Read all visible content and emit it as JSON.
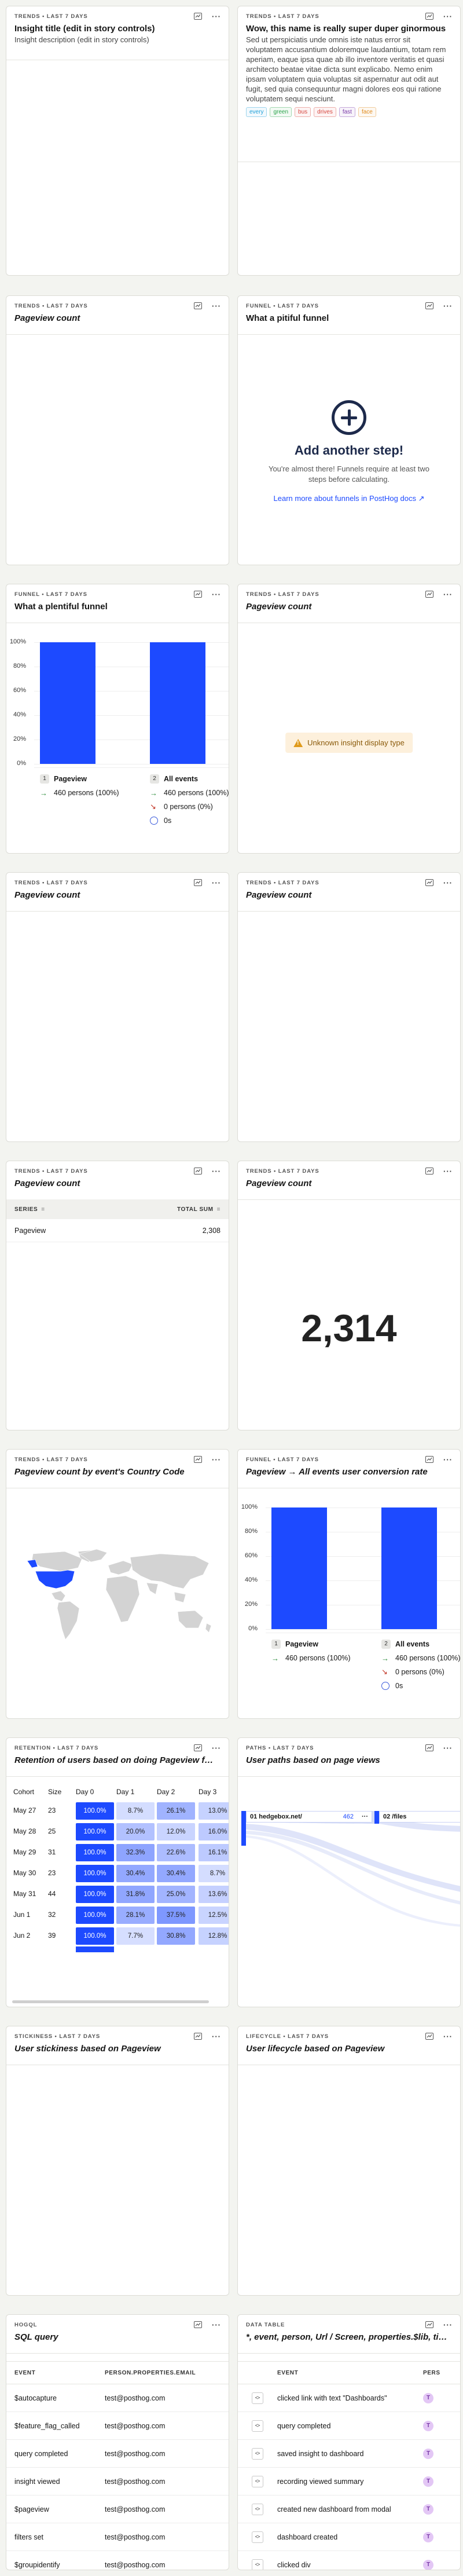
{
  "icons": {
    "chart_icon": "insight-icon",
    "more_icon": "more-icon"
  },
  "cards": {
    "c1": {
      "meta": "TRENDS • LAST 7 DAYS",
      "title": "Insight title (edit in story controls)",
      "desc": "Insight description (edit in story controls)"
    },
    "c2": {
      "meta": "TRENDS • LAST 7 DAYS",
      "title": "Wow, this name is really super duper ginormous",
      "desc": "Sed ut perspiciatis unde omnis iste natus error sit voluptatem accusantium doloremque laudantium, totam rem aperiam, eaque ipsa quae ab illo inventore veritatis et quasi architecto beatae vitae dicta sunt explicabo. Nemo enim ipsam voluptatem quia voluptas sit aspernatur aut odit aut fugit, sed quia consequuntur magni dolores eos qui ratione voluptatem sequi nesciunt.",
      "tags": [
        "every",
        "green",
        "bus",
        "drives",
        "fast",
        "face"
      ],
      "tag_colors": [
        "#1d9fd8",
        "#2aa34a",
        "#d6453d",
        "#d6453d",
        "#7a3aa8",
        "#e08a1a"
      ]
    },
    "c3": {
      "meta": "TRENDS • LAST 7 DAYS",
      "title": "Pageview count"
    },
    "c4": {
      "meta": "FUNNEL • LAST 7 DAYS",
      "title": "What a pitiful funnel",
      "empty_title": "Add another step!",
      "empty_text": "You're almost there! Funnels require at least two steps before calculating.",
      "empty_link": "Learn more about funnels in PostHog docs ↗"
    },
    "c5": {
      "meta": "FUNNEL • LAST 7 DAYS",
      "title": "What a plentiful funnel",
      "y_ticks": [
        "100%",
        "80%",
        "60%",
        "40%",
        "20%",
        "0%"
      ],
      "step1": {
        "num": "1",
        "name": "Pageview",
        "persons": "460 persons (100%)"
      },
      "step2": {
        "num": "2",
        "name": "All events",
        "persons": "460 persons (100%)",
        "dropped": "0 persons (0%)",
        "time": "0s"
      }
    },
    "c6": {
      "meta": "TRENDS • LAST 7 DAYS",
      "title": "Pageview count",
      "warning": "Unknown insight display type"
    },
    "c7": {
      "meta": "TRENDS • LAST 7 DAYS",
      "title": "Pageview count"
    },
    "c8": {
      "meta": "TRENDS • LAST 7 DAYS",
      "title": "Pageview count"
    },
    "c9": {
      "meta": "TRENDS • LAST 7 DAYS",
      "title": "Pageview count",
      "col_series": "SERIES",
      "col_total": "TOTAL SUM",
      "row_label": "Pageview",
      "row_value": "2,308"
    },
    "c10": {
      "meta": "TRENDS • LAST 7 DAYS",
      "title": "Pageview count",
      "number": "2,314"
    },
    "c11": {
      "meta": "TRENDS • LAST 7 DAYS",
      "title": "Pageview count by event's Country Code"
    },
    "c12": {
      "meta": "FUNNEL • LAST 7 DAYS",
      "title": "Pageview → All events user conversion rate",
      "y_ticks": [
        "100%",
        "80%",
        "60%",
        "40%",
        "20%",
        "0%"
      ],
      "step1": {
        "num": "1",
        "name": "Pageview",
        "persons": "460 persons (100%)"
      },
      "step2": {
        "num": "2",
        "name": "All events",
        "persons": "460 persons (100%)",
        "dropped": "0 persons (0%)",
        "time": "0s"
      }
    },
    "c13": {
      "meta": "RETENTION • LAST 7 DAYS",
      "title": "Retention of users based on doing Pageview for the first time",
      "headers": [
        "Cohort",
        "Size",
        "Day 0",
        "Day 1",
        "Day 2",
        "Day 3"
      ],
      "rows": [
        {
          "cohort": "May 27",
          "size": "23",
          "cells": [
            "100.0%",
            "8.7%",
            "26.1%",
            "13.0%"
          ]
        },
        {
          "cohort": "May 28",
          "size": "25",
          "cells": [
            "100.0%",
            "20.0%",
            "12.0%",
            "16.0%"
          ]
        },
        {
          "cohort": "May 29",
          "size": "31",
          "cells": [
            "100.0%",
            "32.3%",
            "22.6%",
            "16.1%"
          ]
        },
        {
          "cohort": "May 30",
          "size": "23",
          "cells": [
            "100.0%",
            "30.4%",
            "30.4%",
            "8.7%"
          ]
        },
        {
          "cohort": "May 31",
          "size": "44",
          "cells": [
            "100.0%",
            "31.8%",
            "25.0%",
            "13.6%"
          ]
        },
        {
          "cohort": "Jun 1",
          "size": "32",
          "cells": [
            "100.0%",
            "28.1%",
            "37.5%",
            "12.5%"
          ]
        },
        {
          "cohort": "Jun 2",
          "size": "39",
          "cells": [
            "100.0%",
            "7.7%",
            "30.8%",
            "12.8%"
          ]
        }
      ]
    },
    "c14": {
      "meta": "PATHS • LAST 7 DAYS",
      "title": "User paths based on page views",
      "node1_label": "01 hedgebox.net/",
      "node1_value": "462",
      "node2_label": "02 /files"
    },
    "c15": {
      "meta": "STICKINESS • LAST 7 DAYS",
      "title": "User stickiness based on Pageview"
    },
    "c16": {
      "meta": "LIFECYCLE • LAST 7 DAYS",
      "title": "User lifecycle based on Pageview"
    },
    "c17": {
      "meta": "HOGQL",
      "title": "SQL query",
      "col_event": "EVENT",
      "col_email": "PERSON.PROPERTIES.EMAIL",
      "rows": [
        {
          "event": "$autocapture",
          "email": "test@posthog.com"
        },
        {
          "event": "$feature_flag_called",
          "email": "test@posthog.com"
        },
        {
          "event": "query completed",
          "email": "test@posthog.com"
        },
        {
          "event": "insight viewed",
          "email": "test@posthog.com"
        },
        {
          "event": "$pageview",
          "email": "test@posthog.com"
        },
        {
          "event": "filters set",
          "email": "test@posthog.com"
        },
        {
          "event": "$groupidentify",
          "email": "test@posthog.com"
        }
      ]
    },
    "c18": {
      "meta": "DATA TABLE",
      "title": "*, event, person, Url / Screen, properties.$lib, timestamp",
      "col_event": "EVENT",
      "col_person": "PERS",
      "rows": [
        {
          "event": "clicked link with text \"Dashboards\"",
          "avatar": "T"
        },
        {
          "event": "query completed",
          "avatar": "T"
        },
        {
          "event": "saved insight to dashboard",
          "avatar": "T"
        },
        {
          "event": "recording viewed summary",
          "avatar": "T"
        },
        {
          "event": "created new dashboard from modal",
          "avatar": "T"
        },
        {
          "event": "dashboard created",
          "avatar": "T"
        },
        {
          "event": "clicked div",
          "avatar": "T"
        }
      ]
    }
  },
  "colors": {
    "primary": "#1d4aff",
    "warning_bg": "#fdf0dc"
  }
}
